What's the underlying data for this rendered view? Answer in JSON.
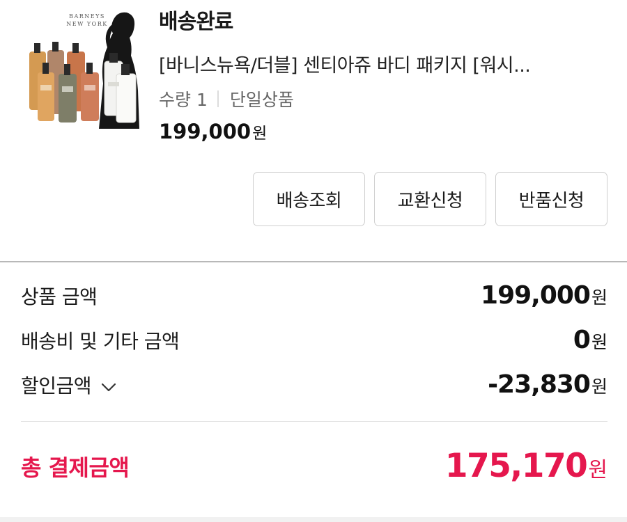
{
  "order": {
    "status": "배송완료",
    "product_name": "[바니스뉴욕/더블] 센티아쥬 바디 패키지 [워시...",
    "quantity_text": "수량 1",
    "option_text": "단일상품",
    "price": "199,000",
    "price_unit": "원",
    "thumbnail": {
      "brand_line1": "BARNEYS",
      "brand_line2": "NEW YORK"
    }
  },
  "actions": [
    {
      "label": "배송조회"
    },
    {
      "label": "교환신청"
    },
    {
      "label": "반품신청"
    }
  ],
  "summary": {
    "product_amount": {
      "label": "상품 금액",
      "value": "199,000",
      "unit": "원"
    },
    "shipping_amount": {
      "label": "배송비 및 기타 금액",
      "value": "0",
      "unit": "원"
    },
    "discount_amount": {
      "label": "할인금액",
      "value": "-23,830",
      "unit": "원",
      "icon": "chevron-down-icon"
    },
    "total_amount": {
      "label": "총 결제금액",
      "value": "175,170",
      "unit": "원"
    }
  },
  "colors": {
    "accent": "#e5174d",
    "border": "#cfcfcf",
    "text": "#1a1a1a",
    "muted": "#666666"
  }
}
